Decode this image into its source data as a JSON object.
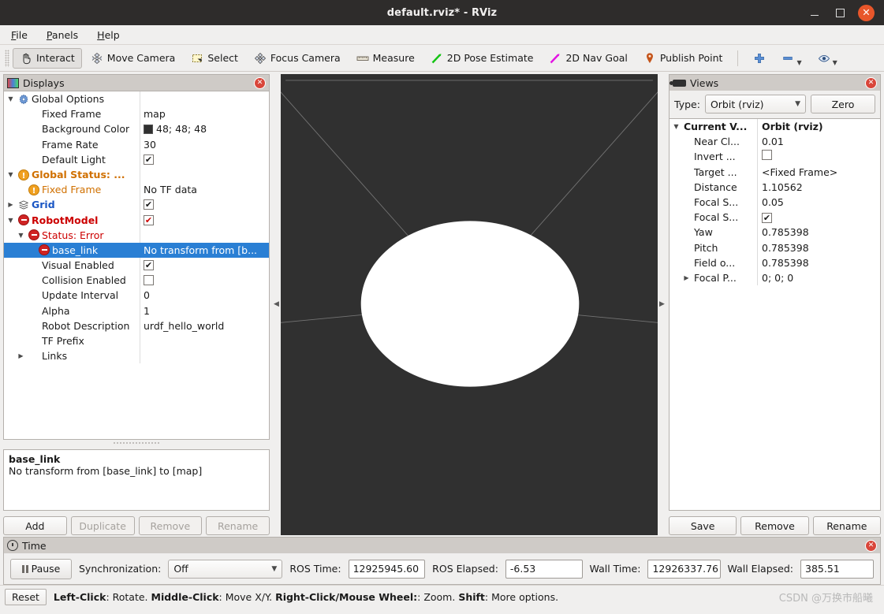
{
  "window": {
    "title": "default.rviz* - RViz",
    "minimize": "–",
    "maximize": "□",
    "close": "✕"
  },
  "menu": {
    "items": [
      "File",
      "Panels",
      "Help"
    ]
  },
  "toolbar": {
    "items": [
      {
        "label": "Interact",
        "icon": "hand-icon",
        "active": true
      },
      {
        "label": "Move Camera",
        "icon": "move-camera-icon",
        "active": false
      },
      {
        "label": "Select",
        "icon": "select-icon",
        "active": false
      },
      {
        "label": "Focus Camera",
        "icon": "focus-camera-icon",
        "active": false
      },
      {
        "label": "Measure",
        "icon": "ruler-icon",
        "active": false
      },
      {
        "label": "2D Pose Estimate",
        "icon": "pose-estimate-icon",
        "active": false
      },
      {
        "label": "2D Nav Goal",
        "icon": "nav-goal-icon",
        "active": false
      },
      {
        "label": "Publish Point",
        "icon": "map-pin-icon",
        "active": false
      }
    ],
    "add_tool": "plus-icon",
    "remove_tool": "minus-icon",
    "visibility_tool": "eye-icon"
  },
  "displays": {
    "title": "Displays",
    "rows": [
      {
        "indent": 0,
        "expander": "down",
        "icon": "gear-icon",
        "label": "Global Options",
        "style": "plain",
        "value": "",
        "valuetype": "none"
      },
      {
        "indent": 1,
        "expander": "none",
        "icon": "none",
        "label": "Fixed Frame",
        "style": "plain",
        "value": "map",
        "valuetype": "text"
      },
      {
        "indent": 1,
        "expander": "none",
        "icon": "none",
        "label": "Background Color",
        "style": "plain",
        "value": "48; 48; 48",
        "valuetype": "color",
        "color": "#303030"
      },
      {
        "indent": 1,
        "expander": "none",
        "icon": "none",
        "label": "Frame Rate",
        "style": "plain",
        "value": "30",
        "valuetype": "text"
      },
      {
        "indent": 1,
        "expander": "none",
        "icon": "none",
        "label": "Default Light",
        "style": "plain",
        "value": "",
        "valuetype": "checkbox",
        "checked": true
      },
      {
        "indent": 0,
        "expander": "down",
        "icon": "warning-icon",
        "label": "Global Status: ...",
        "style": "orange-bold",
        "value": "",
        "valuetype": "none"
      },
      {
        "indent": 1,
        "expander": "none",
        "icon": "warning-icon",
        "label": "Fixed Frame",
        "style": "orange",
        "value": "No TF data",
        "valuetype": "text"
      },
      {
        "indent": 0,
        "expander": "right",
        "icon": "grid-icon",
        "label": "Grid",
        "style": "blue-bold",
        "value": "",
        "valuetype": "checkbox",
        "checked": true
      },
      {
        "indent": 0,
        "expander": "down",
        "icon": "error-icon",
        "label": "RobotModel",
        "style": "red-bold",
        "value": "",
        "valuetype": "checkbox",
        "checked": true,
        "checkred": true
      },
      {
        "indent": 1,
        "expander": "down",
        "icon": "error-icon",
        "label": "Status: Error",
        "style": "red",
        "value": "",
        "valuetype": "none"
      },
      {
        "indent": 2,
        "expander": "none",
        "icon": "error-icon",
        "label": "base_link",
        "style": "plain",
        "value": "No transform from [b...",
        "valuetype": "text",
        "selected": true
      },
      {
        "indent": 1,
        "expander": "none",
        "icon": "none",
        "label": "Visual Enabled",
        "style": "plain",
        "value": "",
        "valuetype": "checkbox",
        "checked": true
      },
      {
        "indent": 1,
        "expander": "none",
        "icon": "none",
        "label": "Collision Enabled",
        "style": "plain",
        "value": "",
        "valuetype": "checkbox",
        "checked": false
      },
      {
        "indent": 1,
        "expander": "none",
        "icon": "none",
        "label": "Update Interval",
        "style": "plain",
        "value": "0",
        "valuetype": "text"
      },
      {
        "indent": 1,
        "expander": "none",
        "icon": "none",
        "label": "Alpha",
        "style": "plain",
        "value": "1",
        "valuetype": "text"
      },
      {
        "indent": 1,
        "expander": "none",
        "icon": "none",
        "label": "Robot Description",
        "style": "plain",
        "value": "urdf_hello_world",
        "valuetype": "text"
      },
      {
        "indent": 1,
        "expander": "none",
        "icon": "none",
        "label": "TF Prefix",
        "style": "plain",
        "value": "",
        "valuetype": "text"
      },
      {
        "indent": 1,
        "expander": "right",
        "icon": "none",
        "label": "Links",
        "style": "plain",
        "value": "",
        "valuetype": "none"
      }
    ],
    "detail": {
      "title": "base_link",
      "message": "No transform from [base_link] to [map]"
    },
    "buttons": [
      {
        "label": "Add",
        "enabled": true
      },
      {
        "label": "Duplicate",
        "enabled": false
      },
      {
        "label": "Remove",
        "enabled": false
      },
      {
        "label": "Rename",
        "enabled": false
      }
    ]
  },
  "views": {
    "title": "Views",
    "type_label": "Type:",
    "type_value": "Orbit (rviz)",
    "zero_button": "Zero",
    "rows": [
      {
        "indent": 0,
        "expander": "down",
        "label": "Current V...",
        "bold": true,
        "value": "Orbit (rviz)",
        "valuetype": "text",
        "valuebold": true
      },
      {
        "indent": 1,
        "expander": "none",
        "label": "Near Cl...",
        "bold": false,
        "value": "0.01",
        "valuetype": "text"
      },
      {
        "indent": 1,
        "expander": "none",
        "label": "Invert ...",
        "bold": false,
        "value": "",
        "valuetype": "checkbox",
        "checked": false
      },
      {
        "indent": 1,
        "expander": "none",
        "label": "Target ...",
        "bold": false,
        "value": "<Fixed Frame>",
        "valuetype": "text"
      },
      {
        "indent": 1,
        "expander": "none",
        "label": "Distance",
        "bold": false,
        "value": "1.10562",
        "valuetype": "text"
      },
      {
        "indent": 1,
        "expander": "none",
        "label": "Focal S...",
        "bold": false,
        "value": "0.05",
        "valuetype": "text"
      },
      {
        "indent": 1,
        "expander": "none",
        "label": "Focal S...",
        "bold": false,
        "value": "",
        "valuetype": "checkbox",
        "checked": true
      },
      {
        "indent": 1,
        "expander": "none",
        "label": "Yaw",
        "bold": false,
        "value": "0.785398",
        "valuetype": "text"
      },
      {
        "indent": 1,
        "expander": "none",
        "label": "Pitch",
        "bold": false,
        "value": "0.785398",
        "valuetype": "text"
      },
      {
        "indent": 1,
        "expander": "none",
        "label": "Field o...",
        "bold": false,
        "value": "0.785398",
        "valuetype": "text"
      },
      {
        "indent": 1,
        "expander": "right",
        "label": "Focal P...",
        "bold": false,
        "value": "0; 0; 0",
        "valuetype": "text"
      }
    ],
    "buttons": [
      {
        "label": "Save",
        "enabled": true
      },
      {
        "label": "Remove",
        "enabled": true
      },
      {
        "label": "Rename",
        "enabled": true
      }
    ]
  },
  "time": {
    "title": "Time",
    "pause_label": "Pause",
    "sync_label": "Synchronization:",
    "sync_value": "Off",
    "ros_time_label": "ROS Time:",
    "ros_time_value": "12925945.60",
    "ros_elapsed_label": "ROS Elapsed:",
    "ros_elapsed_value": "-6.53",
    "wall_time_label": "Wall Time:",
    "wall_time_value": "12926337.76",
    "wall_elapsed_label": "Wall Elapsed:",
    "wall_elapsed_value": "385.51"
  },
  "statusbar": {
    "reset_label": "Reset",
    "help_segments": [
      {
        "text": "Left-Click",
        "bold": true
      },
      {
        "text": ": Rotate. ",
        "bold": false
      },
      {
        "text": "Middle-Click",
        "bold": true
      },
      {
        "text": ": Move X/Y. ",
        "bold": false
      },
      {
        "text": "Right-Click/Mouse Wheel:",
        "bold": true
      },
      {
        "text": ": Zoom. ",
        "bold": false
      },
      {
        "text": "Shift",
        "bold": true
      },
      {
        "text": ": More options.",
        "bold": false
      }
    ],
    "watermark": "CSDN @万换市船曦"
  },
  "viewport": {
    "background_color": "#303030",
    "grid_color": "#8a8a8a",
    "model_color": "#ffffff"
  }
}
